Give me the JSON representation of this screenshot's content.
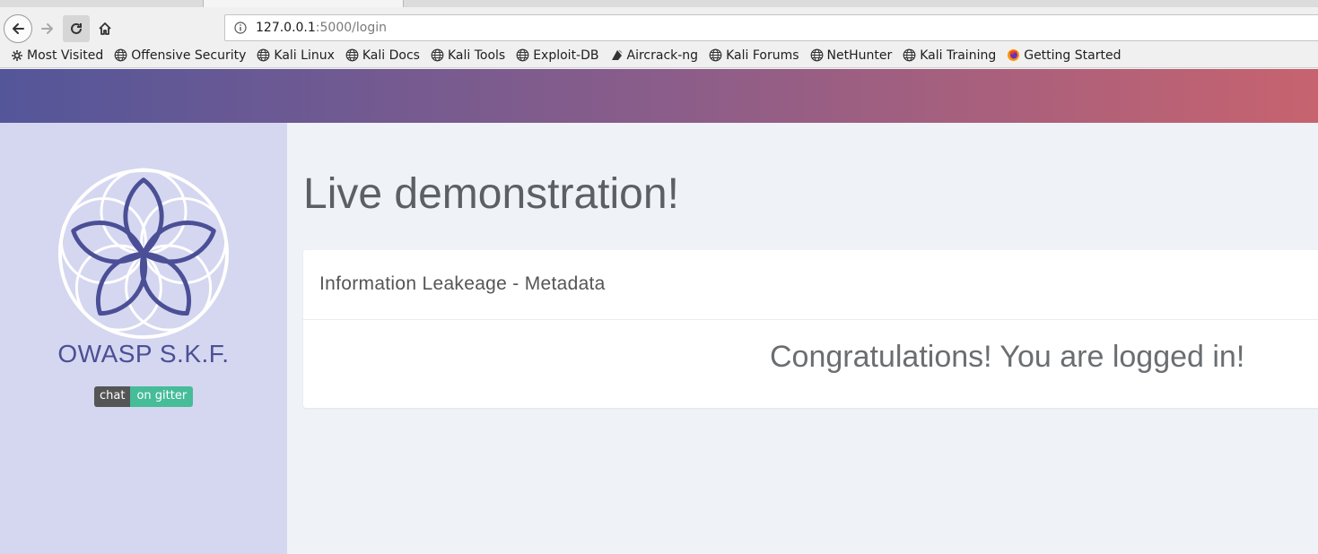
{
  "browser": {
    "url_host": "127.0.0.1",
    "url_path": ":5000/login",
    "bookmarks": [
      {
        "label": "Most Visited",
        "icon": "gear-icon"
      },
      {
        "label": "Offensive Security",
        "icon": "globe-icon"
      },
      {
        "label": "Kali Linux",
        "icon": "globe-icon"
      },
      {
        "label": "Kali Docs",
        "icon": "globe-icon"
      },
      {
        "label": "Kali Tools",
        "icon": "globe-icon"
      },
      {
        "label": "Exploit-DB",
        "icon": "globe-icon"
      },
      {
        "label": "Aircrack-ng",
        "icon": "aircrack-icon"
      },
      {
        "label": "Kali Forums",
        "icon": "globe-icon"
      },
      {
        "label": "NetHunter",
        "icon": "globe-icon"
      },
      {
        "label": "Kali Training",
        "icon": "globe-icon"
      },
      {
        "label": "Getting Started",
        "icon": "firefox-icon"
      }
    ]
  },
  "sidebar": {
    "brand": "OWASP S.K.F.",
    "badge_left": "chat",
    "badge_right": "on gitter"
  },
  "main": {
    "title": "Live demonstration!",
    "card_title": "Information Leakeage - Metadata",
    "message": "Congratulations! You are logged in!"
  },
  "colors": {
    "banner_start": "#54569a",
    "banner_end": "#c7636f",
    "sidebar_bg": "#d5d7f0",
    "brand": "#4b4f96",
    "gitter_green": "#46bc99"
  }
}
